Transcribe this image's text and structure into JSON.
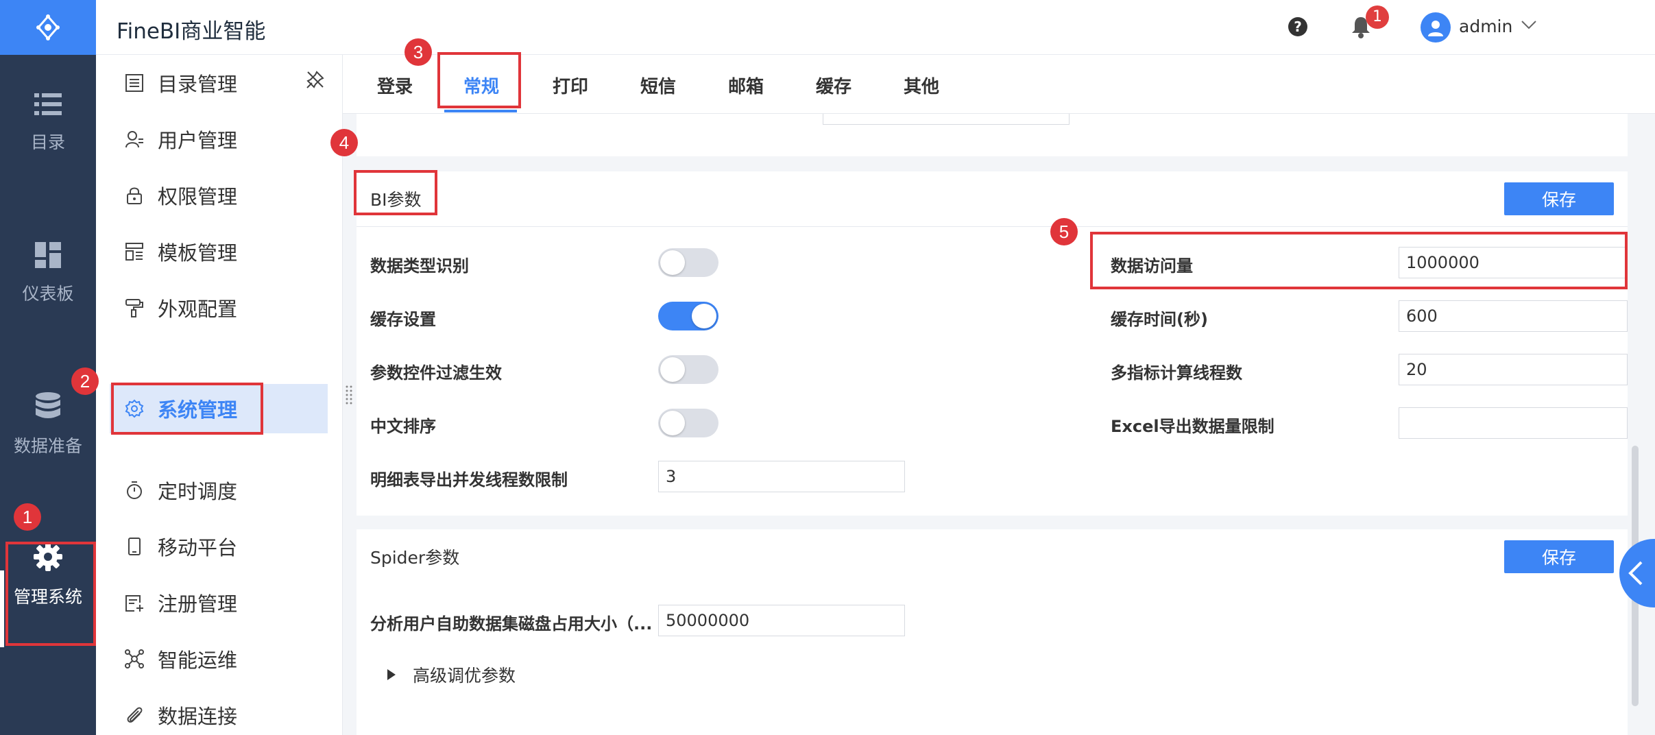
{
  "app": {
    "title": "FineBI商业智能"
  },
  "nav_rail": [
    {
      "label": "目录",
      "icon": "list-icon"
    },
    {
      "label": "仪表板",
      "icon": "dashboard-icon"
    },
    {
      "label": "数据准备",
      "icon": "database-icon"
    },
    {
      "label": "管理系统",
      "icon": "gear-icon",
      "active": true
    }
  ],
  "header": {
    "notification_count": "1",
    "user": "admin"
  },
  "submenu": [
    {
      "label": "目录管理",
      "icon": "directory-icon"
    },
    {
      "label": "用户管理",
      "icon": "user-icon"
    },
    {
      "label": "权限管理",
      "icon": "lock-icon"
    },
    {
      "label": "模板管理",
      "icon": "template-icon"
    },
    {
      "label": "外观配置",
      "icon": "paint-roller-icon"
    },
    {
      "label": "系统管理",
      "icon": "gear-icon",
      "active": true
    },
    {
      "label": "定时调度",
      "icon": "timer-icon"
    },
    {
      "label": "移动平台",
      "icon": "mobile-icon"
    },
    {
      "label": "注册管理",
      "icon": "register-icon"
    },
    {
      "label": "智能运维",
      "icon": "network-icon"
    },
    {
      "label": "数据连接",
      "icon": "paperclip-icon"
    }
  ],
  "tabs": [
    "登录",
    "常规",
    "打印",
    "短信",
    "邮箱",
    "缓存",
    "其他"
  ],
  "active_tab": "常规",
  "bi_params": {
    "title": "BI参数",
    "save_label": "保存",
    "left": [
      {
        "label": "数据类型识别",
        "type": "toggle",
        "on": false
      },
      {
        "label": "缓存设置",
        "type": "toggle",
        "on": true
      },
      {
        "label": "参数控件过滤生效",
        "type": "toggle",
        "on": false
      },
      {
        "label": "中文排序",
        "type": "toggle",
        "on": false
      },
      {
        "label": "明细表导出并发线程数限制",
        "type": "input",
        "value": "3"
      }
    ],
    "right": [
      {
        "label": "数据访问量",
        "value": "1000000"
      },
      {
        "label": "缓存时间(秒)",
        "value": "600"
      },
      {
        "label": "多指标计算线程数",
        "value": "20"
      },
      {
        "label": "Excel导出数据量限制",
        "value": ""
      }
    ]
  },
  "spider_params": {
    "title": "Spider参数",
    "save_label": "保存",
    "disk_label": "分析用户自助数据集磁盘占用大小（...",
    "disk_value": "50000000",
    "advanced_label": "高级调优参数"
  },
  "annotations": [
    "1",
    "2",
    "3",
    "4",
    "5"
  ],
  "colors": {
    "rail_bg": "#2a3a54",
    "accent": "#3d85f5",
    "annotation": "#e0353a"
  }
}
